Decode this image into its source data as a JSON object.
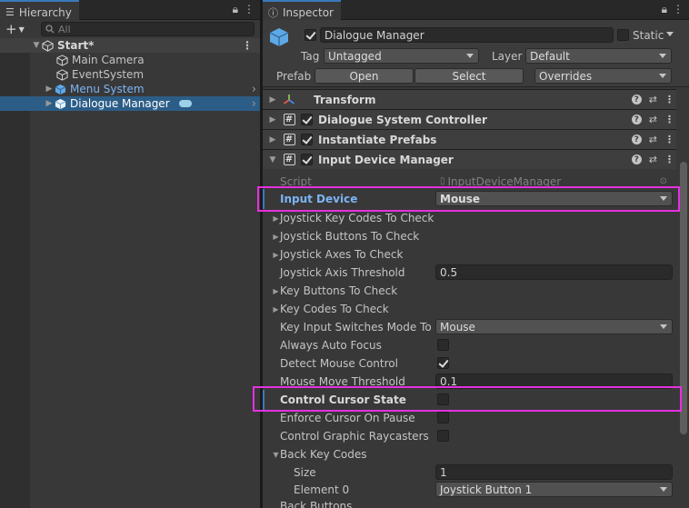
{
  "hierarchy": {
    "tab_title": "Hierarchy",
    "search_placeholder": "All",
    "items": [
      {
        "label": "Start*"
      },
      {
        "label": "Main Camera"
      },
      {
        "label": "EventSystem"
      },
      {
        "label": "Menu System"
      },
      {
        "label": "Dialogue Manager"
      }
    ]
  },
  "inspector": {
    "tab_title": "Inspector",
    "object_name": "Dialogue Manager",
    "static_label": "Static",
    "tag_label": "Tag",
    "tag_value": "Untagged",
    "layer_label": "Layer",
    "layer_value": "Default",
    "prefab_label": "Prefab",
    "open_label": "Open",
    "select_label": "Select",
    "overrides_label": "Overrides",
    "components": [
      {
        "name": "Transform"
      },
      {
        "name": "Dialogue System Controller"
      },
      {
        "name": "Instantiate Prefabs"
      },
      {
        "name": "Input Device Manager"
      }
    ],
    "properties": {
      "script_label": "Script",
      "script_value": "InputDeviceManager",
      "input_device_label": "Input Device",
      "input_device_value": "Mouse",
      "joystick_key_codes": "Joystick Key Codes To Check",
      "joystick_buttons": "Joystick Buttons To Check",
      "joystick_axes": "Joystick Axes To Check",
      "joystick_axis_threshold_label": "Joystick Axis Threshold",
      "joystick_axis_threshold_value": "0.5",
      "key_buttons": "Key Buttons To Check",
      "key_codes": "Key Codes To Check",
      "key_input_switches_label": "Key Input Switches Mode To",
      "key_input_switches_value": "Mouse",
      "always_auto_focus": "Always Auto Focus",
      "detect_mouse_control": "Detect Mouse Control",
      "mouse_move_threshold_label": "Mouse Move Threshold",
      "mouse_move_threshold_value": "0.1",
      "control_cursor_state": "Control Cursor State",
      "enforce_cursor_on_pause": "Enforce Cursor On Pause",
      "control_graphic_raycasters": "Control Graphic Raycasters",
      "back_key_codes": "Back Key Codes",
      "size_label": "Size",
      "size_value": "1",
      "element0_label": "Element 0",
      "element0_value": "Joystick Button 1",
      "back_buttons": "Back Buttons"
    }
  },
  "colors": {
    "selection": "#2c5d87",
    "highlight_box": "#e530e0",
    "accent_blue": "#7cb4f5",
    "tab_accent": "#3a79bb"
  }
}
